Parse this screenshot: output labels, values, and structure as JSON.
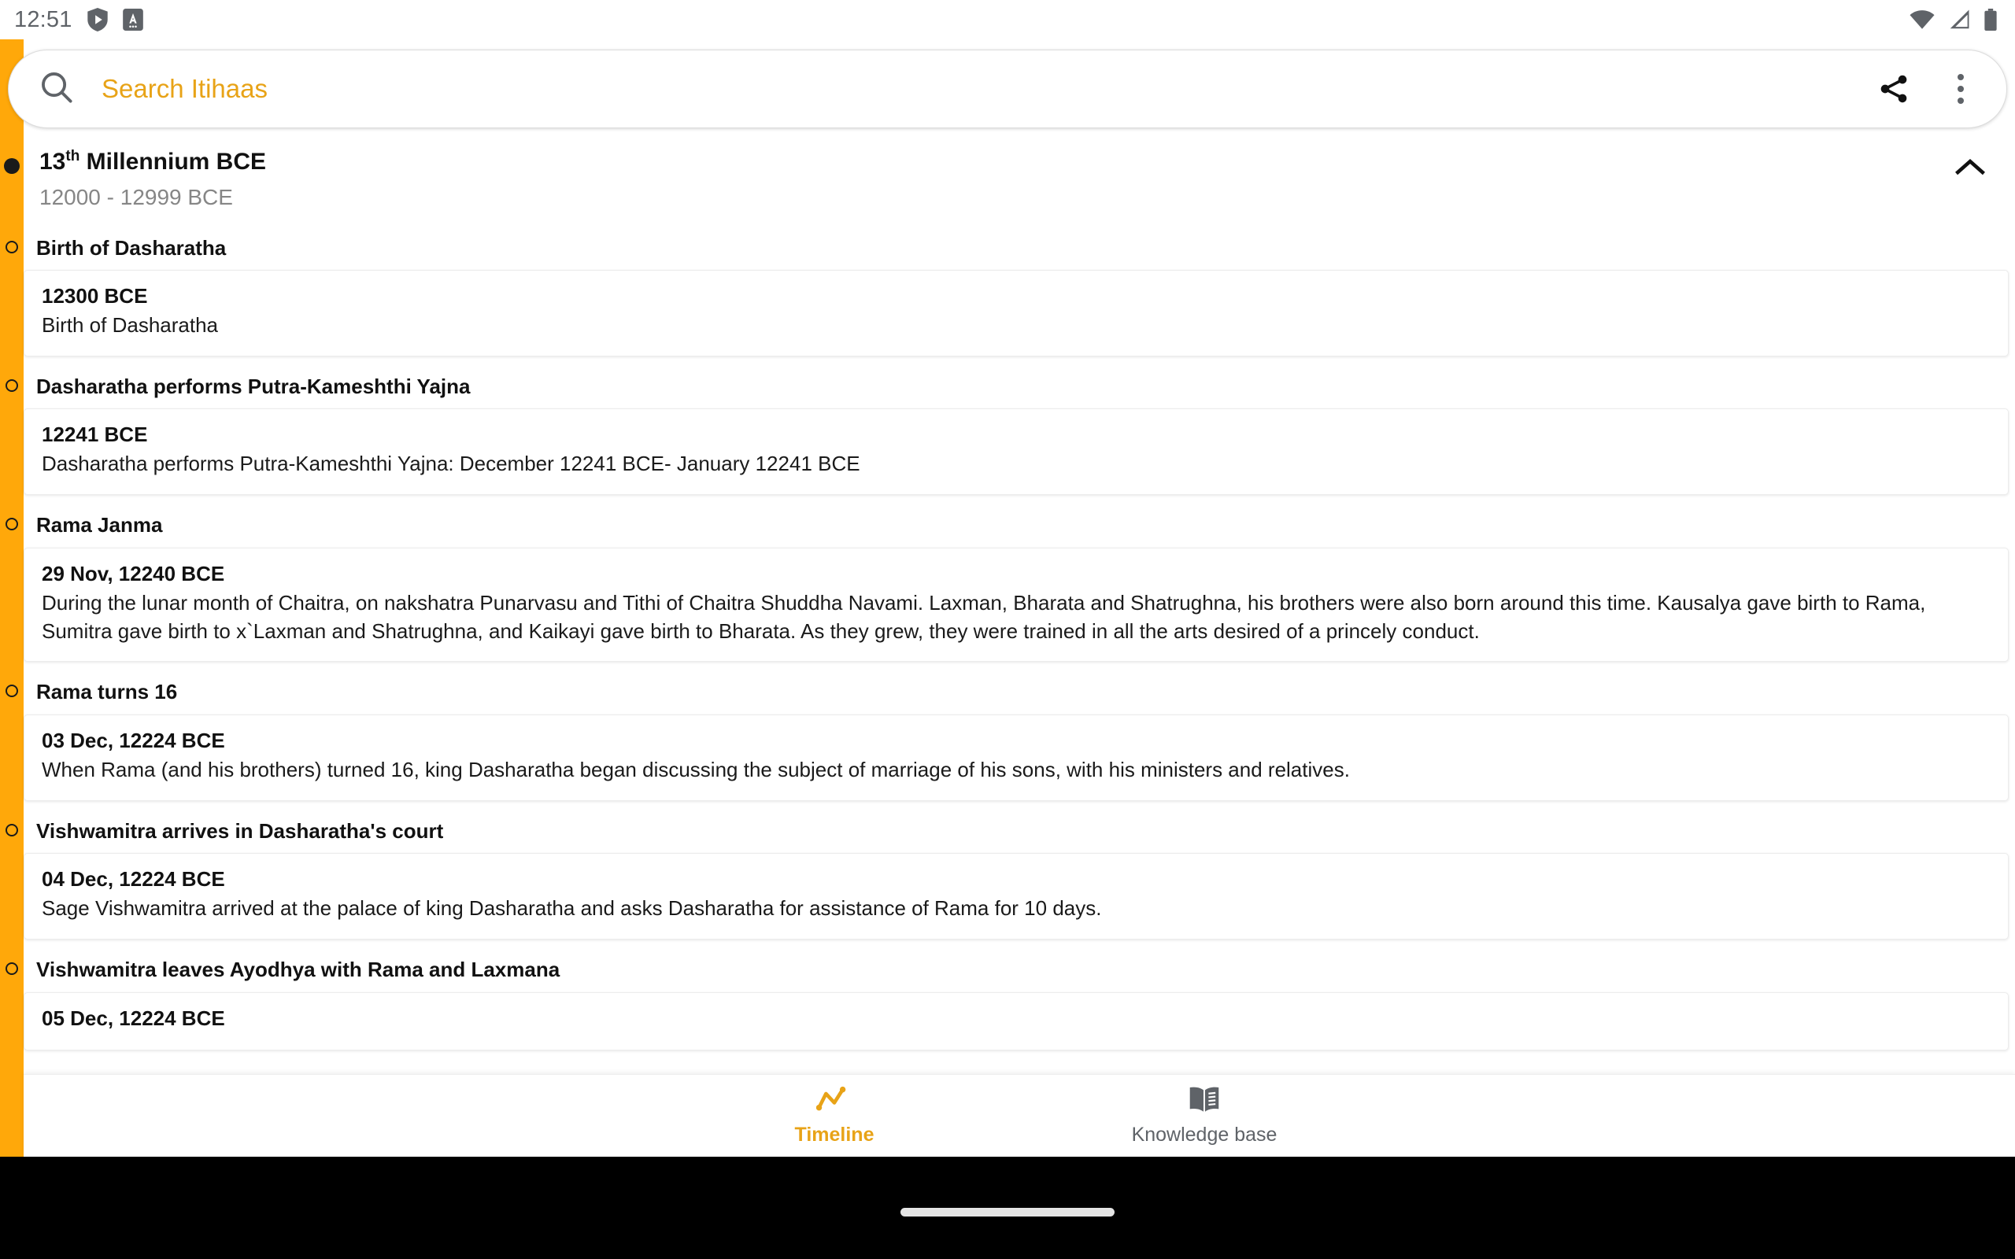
{
  "status_bar": {
    "clock": "12:51",
    "left_icons": [
      "shield-play-icon",
      "app-badge-icon"
    ],
    "right_icons": [
      "wifi-icon",
      "cell-signal-icon",
      "battery-icon"
    ]
  },
  "search": {
    "placeholder": "Search Itihaas",
    "value": "",
    "icon": "search-icon",
    "share_icon": "share-icon",
    "overflow_icon": "more-vertical-icon"
  },
  "colors": {
    "accent": "#ffa80a",
    "accent_text": "#e8a317",
    "rail": "#ffa80a",
    "muted_text": "#868686",
    "body_text": "#1a1a1a"
  },
  "era": {
    "title_number": "13",
    "title_ordinal": "th",
    "title_rest": " Millennium BCE",
    "range": "12000 - 12999 BCE",
    "collapse_icon": "chevron-up-icon",
    "expanded": true
  },
  "events": [
    {
      "title": "Birth of Dasharatha",
      "date": "12300 BCE",
      "description": "Birth of Dasharatha"
    },
    {
      "title": "Dasharatha performs Putra-Kameshthi Yajna",
      "date": "12241 BCE",
      "description": "Dasharatha performs Putra-Kameshthi Yajna: December 12241 BCE- January 12241 BCE"
    },
    {
      "title": "Rama Janma",
      "date": "29 Nov, 12240 BCE",
      "description": "During the lunar month of Chaitra, on nakshatra Punarvasu and Tithi of Chaitra Shuddha Navami. Laxman, Bharata and Shatrughna, his brothers were also born around this time. Kausalya gave birth to Rama, Sumitra gave birth to x`Laxman and Shatrughna, and Kaikayi gave birth to Bharata. As they grew, they were trained in all the arts desired of a princely conduct."
    },
    {
      "title": "Rama turns 16",
      "date": "03 Dec, 12224 BCE",
      "description": "When Rama (and his brothers) turned 16, king Dasharatha began discussing the subject of marriage of his sons, with his ministers and relatives."
    },
    {
      "title": "Vishwamitra arrives in Dasharatha's court",
      "date": "04 Dec, 12224 BCE",
      "description": "Sage Vishwamitra arrived at the palace of king Dasharatha and asks Dasharatha for assistance of Rama for 10 days."
    },
    {
      "title": "Vishwamitra leaves Ayodhya with Rama and Laxmana",
      "date": "05 Dec, 12224 BCE",
      "description": ""
    }
  ],
  "bottom_nav": {
    "items": [
      {
        "label": "Timeline",
        "icon": "trending-line-icon",
        "active": true
      },
      {
        "label": "Knowledge base",
        "icon": "open-book-icon",
        "active": false
      }
    ]
  }
}
